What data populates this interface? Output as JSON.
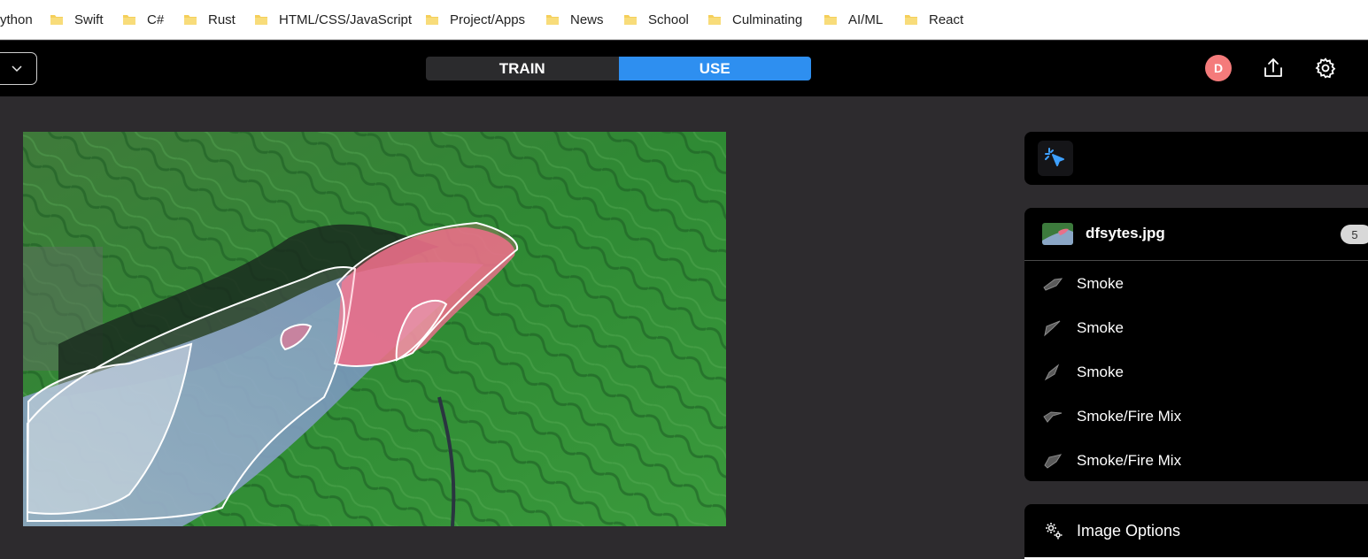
{
  "bookmarks": {
    "first_partial": "ython",
    "items": [
      {
        "label": "Swift"
      },
      {
        "label": "C#"
      },
      {
        "label": "Rust"
      },
      {
        "label": "HTML/CSS/JavaScript"
      },
      {
        "label": "Project/Apps"
      },
      {
        "label": "News"
      },
      {
        "label": "School"
      },
      {
        "label": "Culminating"
      },
      {
        "label": "AI/ML"
      },
      {
        "label": "React"
      }
    ]
  },
  "header": {
    "modes": [
      "TRAIN",
      "USE"
    ],
    "active_mode": "USE",
    "avatar_initial": "D",
    "accent": "#2e8ff0",
    "avatar_color": "#f47b7b"
  },
  "tools": {
    "active_tool_icon": "sparkle-cursor-icon"
  },
  "file": {
    "name": "dfsytes.jpg",
    "annotation_count": "5",
    "labels": [
      {
        "label": "Smoke"
      },
      {
        "label": "Smoke"
      },
      {
        "label": "Smoke"
      },
      {
        "label": "Smoke/Fire Mix"
      },
      {
        "label": "Smoke/Fire Mix"
      }
    ]
  },
  "image_options": {
    "label": "Image Options"
  }
}
